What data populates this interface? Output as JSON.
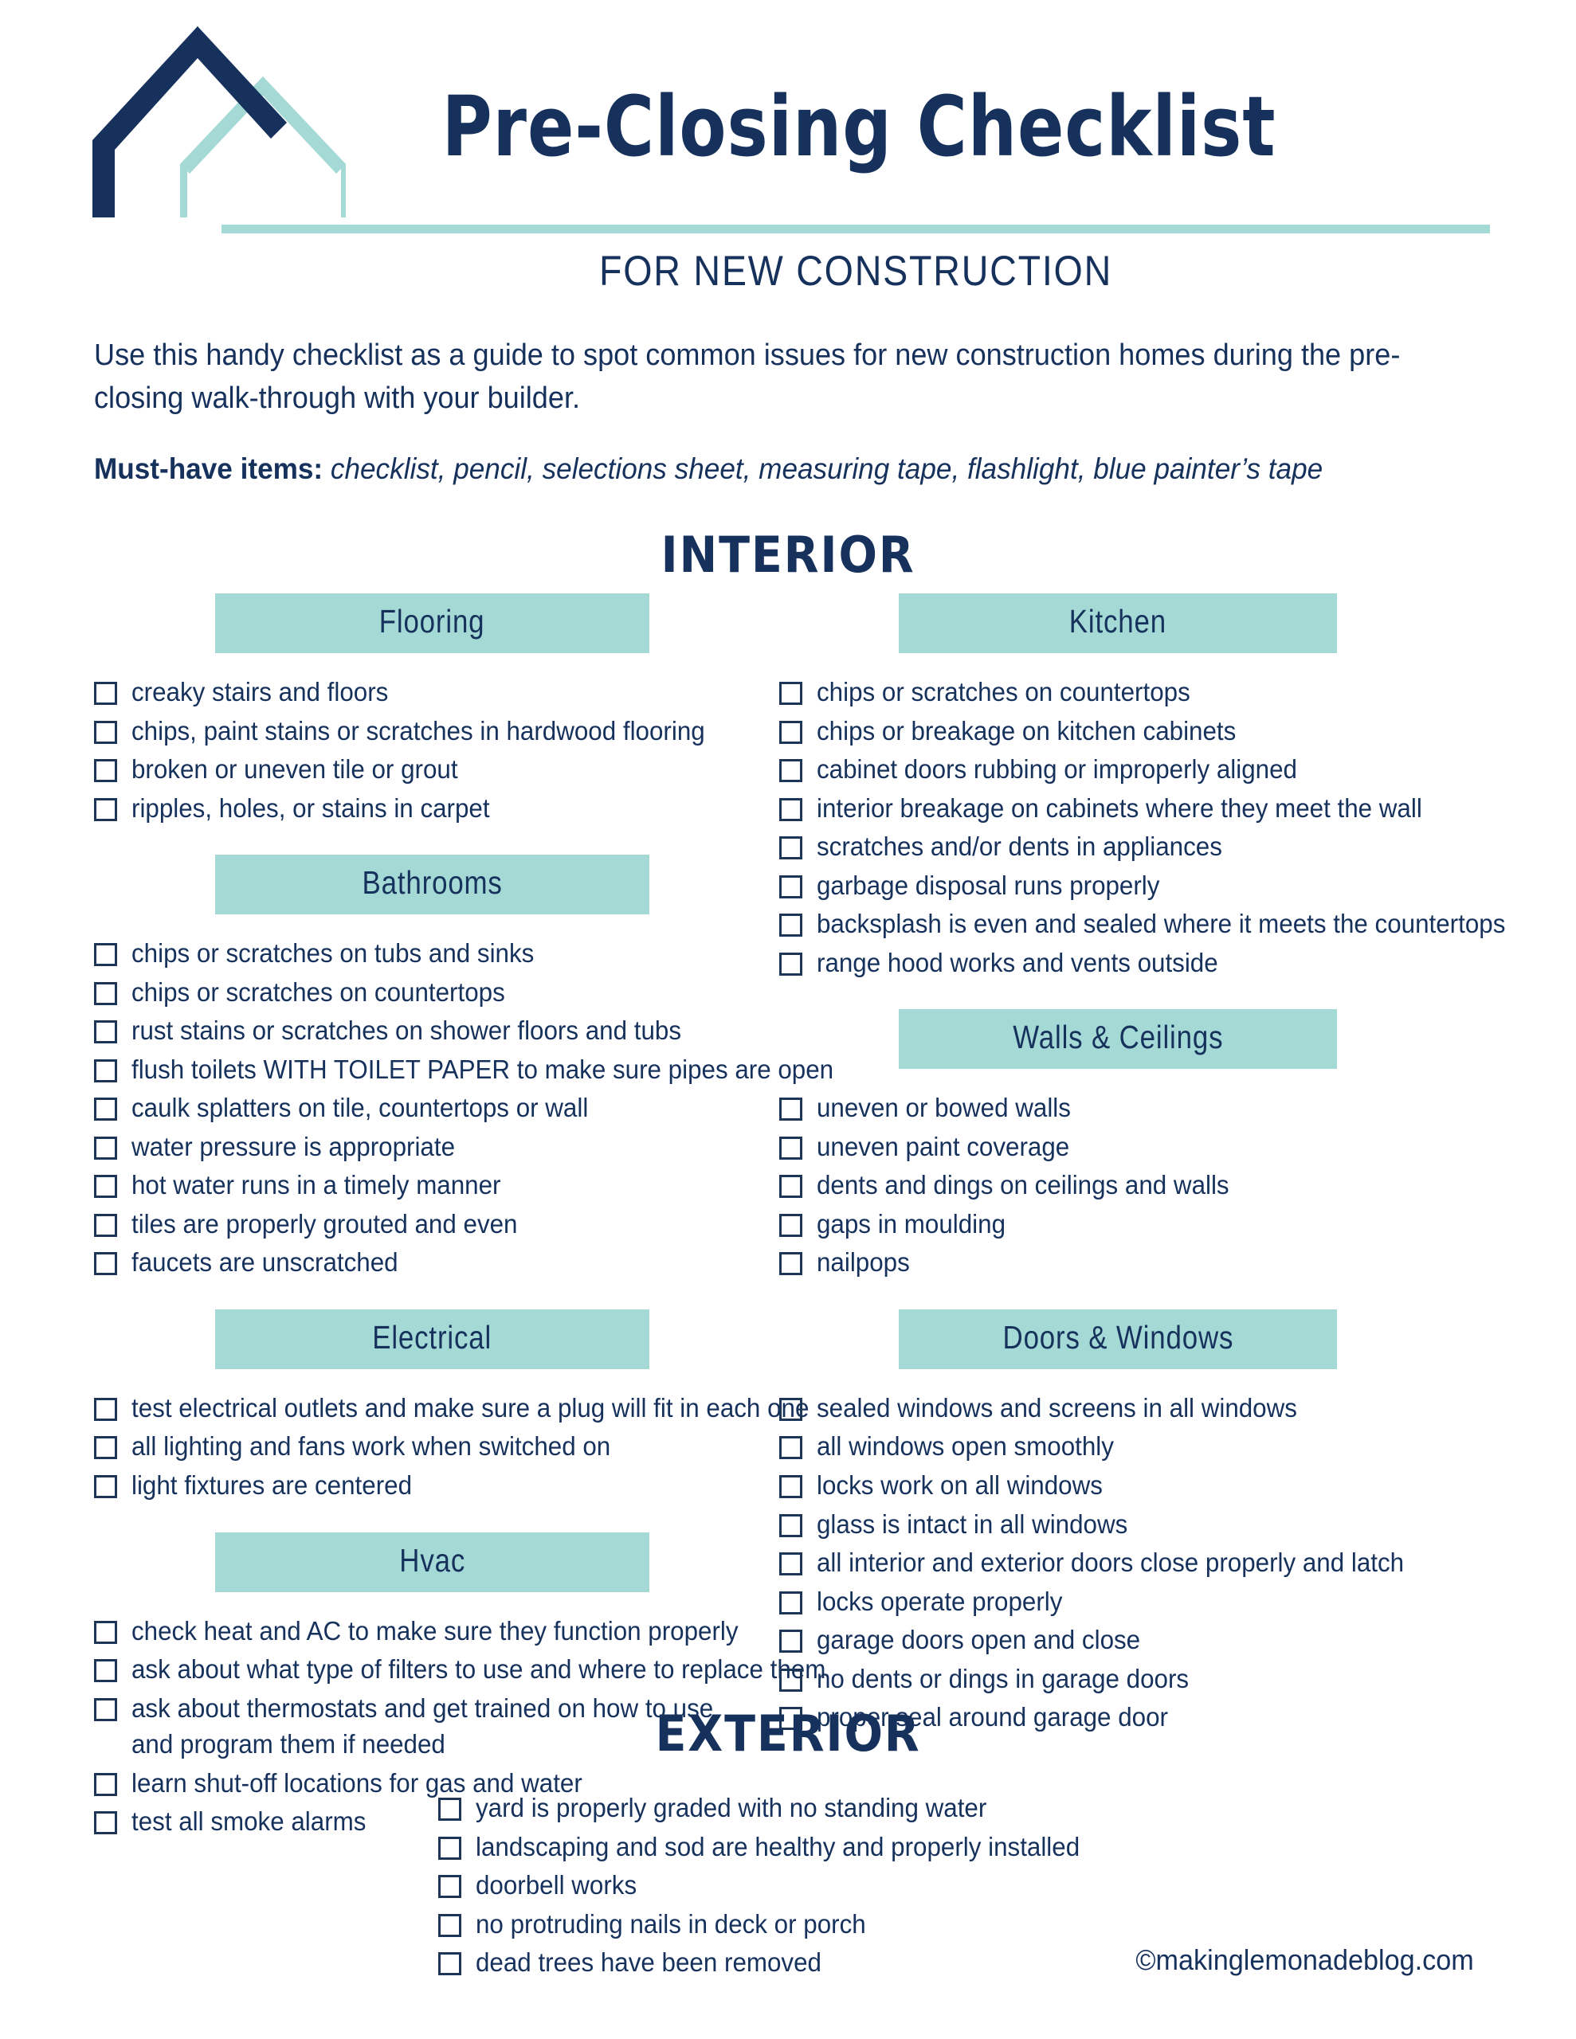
{
  "header": {
    "title": "Pre-Closing Checklist",
    "subtitle": "FOR NEW CONSTRUCTION",
    "logo_icon": "house-outline-icon"
  },
  "intro": {
    "paragraph": "Use this handy checklist as a guide to spot common issues for new construction homes during the pre-closing walk-through with your builder.",
    "must_have_label": "Must-have items:",
    "must_have_items": "checklist, pencil, selections sheet, measuring tape, flashlight, blue painter’s tape"
  },
  "sections": {
    "interior_title": "INTERIOR",
    "exterior_title": "EXTERIOR"
  },
  "colors": {
    "navy": "#16325c",
    "teal": "#a5d9d5",
    "checkbox_border": "#1d3557",
    "page_background": "#ffffff"
  },
  "categories": {
    "flooring": {
      "label": "Flooring",
      "items": [
        "creaky stairs and floors",
        "chips, paint stains or scratches in hardwood flooring",
        "broken or uneven tile or grout",
        "ripples, holes, or stains in carpet"
      ]
    },
    "bathrooms": {
      "label": "Bathrooms",
      "items": [
        "chips or scratches on tubs and sinks",
        "chips or scratches on countertops",
        "rust stains or scratches on shower floors and tubs",
        "flush toilets WITH TOILET PAPER to make sure pipes are open",
        "caulk splatters on tile, countertops or wall",
        "water pressure is appropriate",
        "hot water runs in a timely manner",
        "tiles are properly grouted and even",
        "faucets are unscratched"
      ]
    },
    "electrical": {
      "label": "Electrical",
      "items": [
        "test electrical outlets and make sure a plug will fit in each one",
        "all lighting and fans work when switched on",
        "light fixtures are centered"
      ]
    },
    "hvac": {
      "label": "Hvac",
      "items": [
        "check heat and AC to make sure they function properly",
        "ask about what type of filters to use and where to replace them",
        "ask about thermostats and get trained on how to use and program them if needed",
        "learn shut-off locations for gas and water",
        "test all smoke alarms"
      ]
    },
    "kitchen": {
      "label": "Kitchen",
      "items": [
        "chips or scratches on countertops",
        "chips or breakage on kitchen cabinets",
        "cabinet doors rubbing or improperly aligned",
        "interior breakage on cabinets where they meet the wall",
        "scratches and/or dents in appliances",
        "garbage disposal runs properly",
        "backsplash is even and sealed where it meets the countertops",
        "range hood works and vents outside"
      ]
    },
    "walls_ceilings": {
      "label": "Walls & Ceilings",
      "items": [
        "uneven or bowed walls",
        "uneven paint coverage",
        "dents and dings on ceilings and walls",
        "gaps in moulding",
        "nailpops"
      ]
    },
    "doors_windows": {
      "label": "Doors & Windows",
      "items": [
        "sealed windows and screens in all windows",
        "all windows open smoothly",
        "locks work on all windows",
        "glass is intact in all windows",
        "all interior and exterior doors close properly and latch",
        "locks operate properly",
        "garage doors open and close",
        "no dents or dings in garage doors",
        "proper seal around garage door"
      ]
    },
    "exterior": {
      "items": [
        "yard is properly graded with no standing water",
        "landscaping and sod are healthy and properly installed",
        "doorbell works",
        "no protruding nails in deck or porch",
        "dead trees have been removed"
      ]
    }
  },
  "footer": {
    "credit": "©makinglemonadeblog.com"
  }
}
